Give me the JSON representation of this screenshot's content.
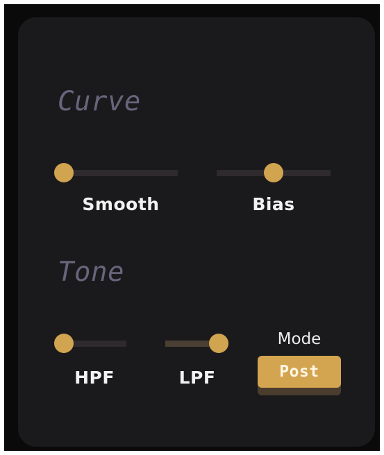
{
  "sections": {
    "curve_title": "Curve",
    "tone_title": "Tone"
  },
  "sliders": {
    "smooth": {
      "label": "Smooth",
      "value": 0.0
    },
    "bias": {
      "label": "Bias",
      "value": 0.5
    },
    "hpf": {
      "label": "HPF",
      "value": 0.0
    },
    "lpf": {
      "label": "LPF",
      "value": 1.0
    }
  },
  "mode": {
    "label": "Mode",
    "value": "Post"
  },
  "colors": {
    "accent": "#d1a44f",
    "track": "#2e2a2d",
    "panel": "#1a1a1d",
    "section_title": "#68647b"
  }
}
